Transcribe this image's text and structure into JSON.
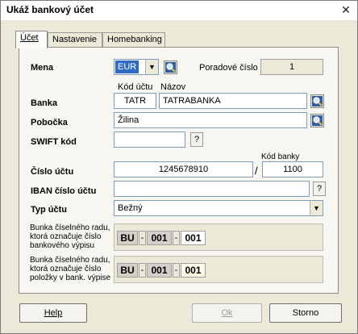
{
  "window": {
    "title": "Ukáž bankový účet",
    "close_glyph": "✕"
  },
  "tabs": [
    {
      "label": "Účet"
    },
    {
      "label": "Nastavenie"
    },
    {
      "label": "Homebanking"
    }
  ],
  "form": {
    "mena_label": "Mena",
    "mena_value": "EUR",
    "poradove_label": "Poradové číslo",
    "poradove_value": "1",
    "kod_uctu_caption": "Kód účtu",
    "nazov_caption": "Názov",
    "banka_label": "Banka",
    "banka_code": "TATR",
    "banka_name": "TATRABANKA",
    "pobocka_label": "Pobočka",
    "pobocka_value": "Žilina",
    "swift_label": "SWIFT kód",
    "swift_value": "",
    "kod_banky_caption": "Kód banky",
    "cislo_uctu_label": "Číslo účtu",
    "cislo_uctu_value": "1245678910",
    "slash": "/",
    "kod_banky_value": "1100",
    "iban_label": "IBAN číslo účtu",
    "iban_value": "",
    "typ_uctu_label": "Typ účtu",
    "typ_uctu_value": "Bežný",
    "question": "?"
  },
  "groups": [
    {
      "label_lines": [
        "Bunka číselného radu,",
        "ktorá označuje číslo",
        "bankového výpisu"
      ],
      "seg1": "BU",
      "seg2": "001",
      "seg3": "001",
      "dash": "-"
    },
    {
      "label_lines": [
        "Bunka číselného radu,",
        "ktorá označuje číslo",
        "položky v bank. výpise"
      ],
      "seg1": "BU",
      "seg2": "001",
      "seg3": "001",
      "dash": "-"
    }
  ],
  "buttons": {
    "help": "Help",
    "ok": "Ok",
    "storno": "Storno"
  },
  "icons": {
    "lookup": "magnifier-icon",
    "dropdown": "chevron-down-icon"
  }
}
